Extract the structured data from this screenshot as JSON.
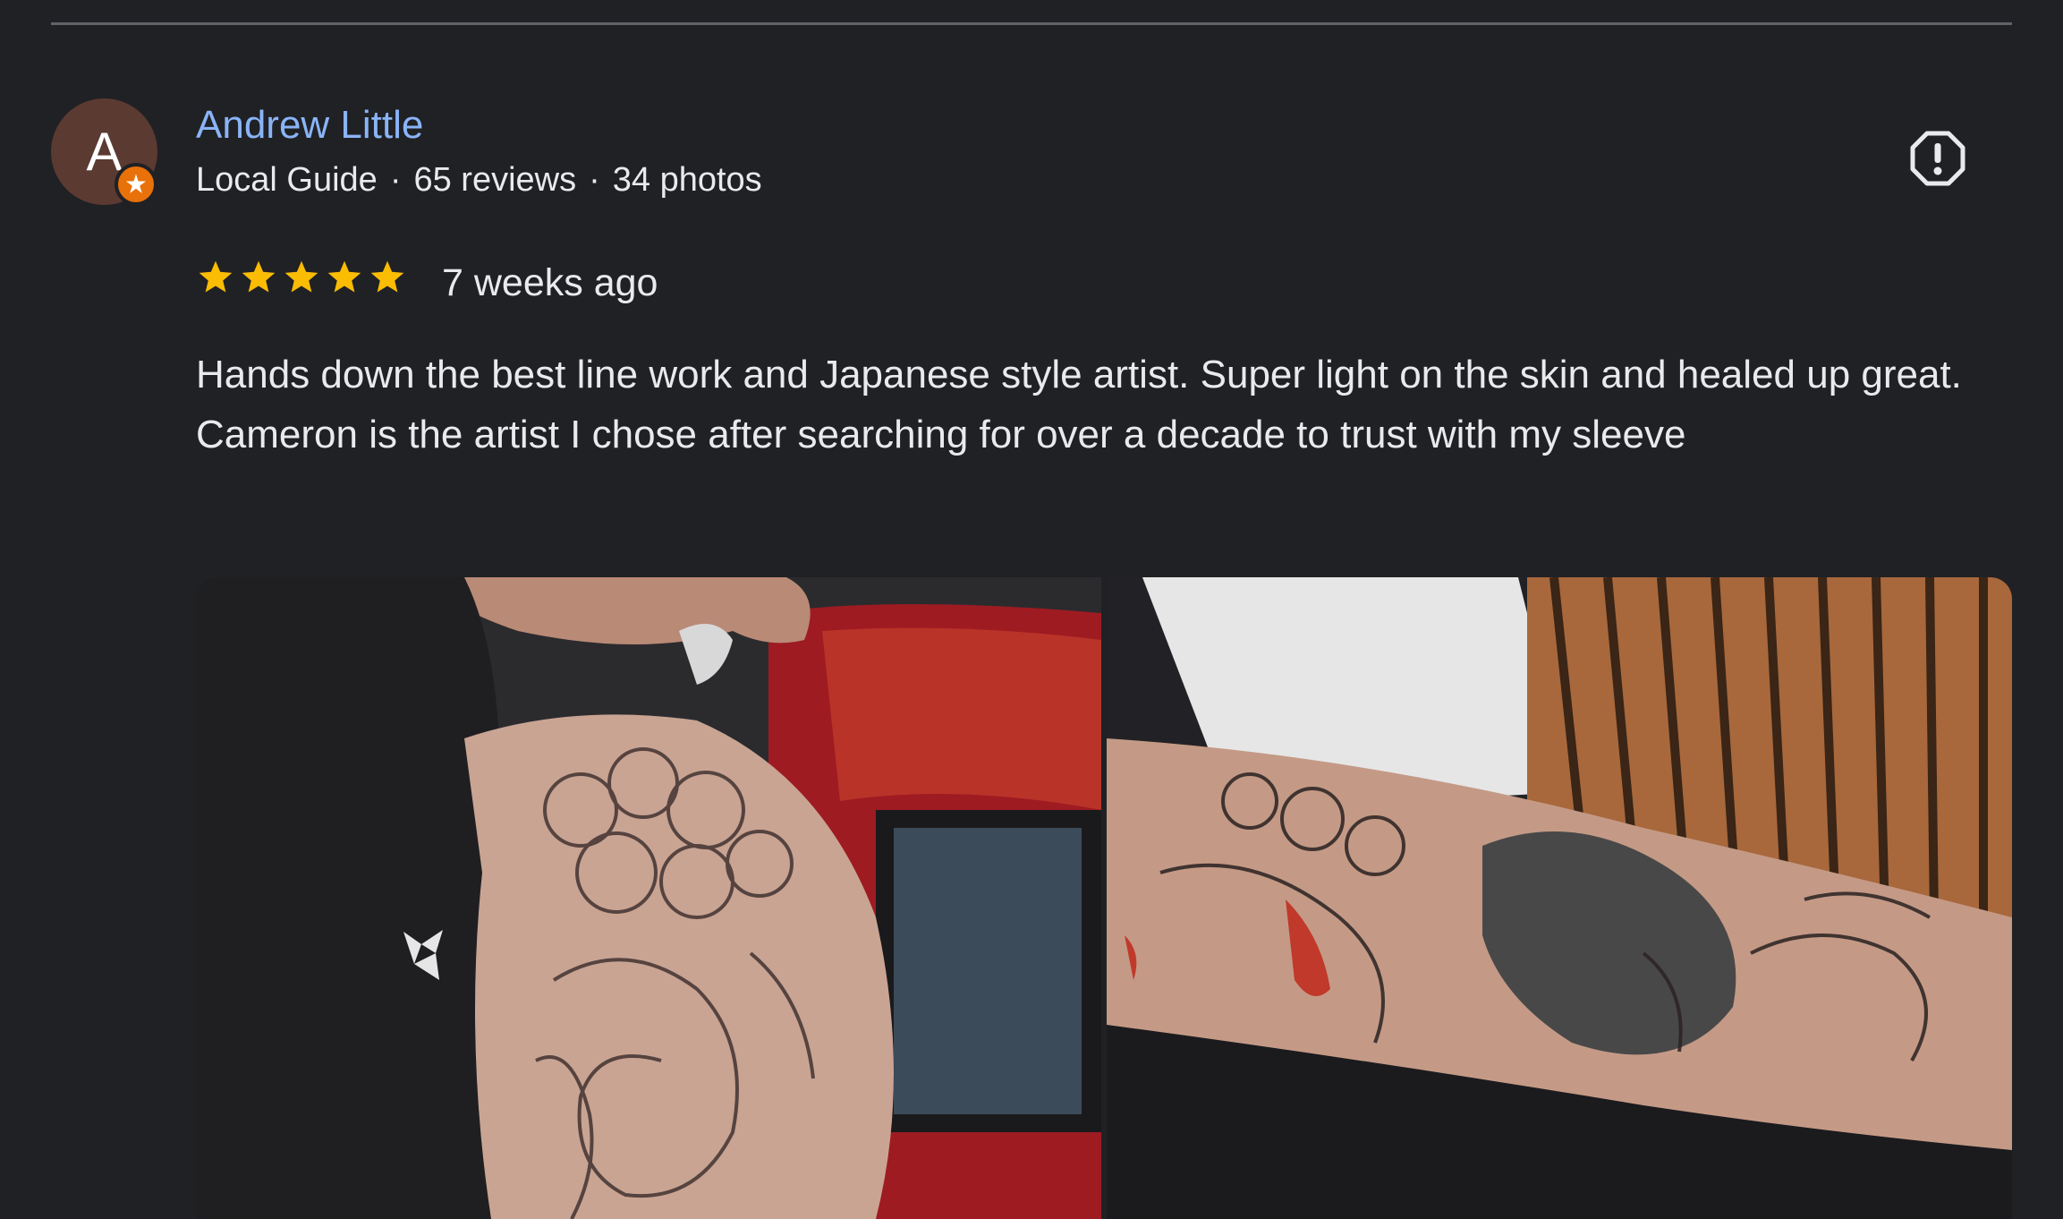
{
  "review": {
    "reviewer": {
      "avatar_initial": "A",
      "avatar_color": "#5b3a32",
      "badge_icon": "local-guide-star-icon",
      "badge_color": "#e8710a",
      "name": "Andrew Little",
      "role": "Local Guide",
      "separator": "·",
      "reviews_count": "65 reviews",
      "photos_count": "34 photos"
    },
    "report_icon": "report-exclamation-icon",
    "rating": 5,
    "rating_max": 5,
    "star_color": "#fbbc04",
    "timestamp": "7 weeks ago",
    "text": "Hands down the best line work and Japanese style artist. Super light on the skin and healed up great. Cameron is the artist I chose after searching for over a decade to trust with my sleeve",
    "photos": [
      {
        "subject": "shoulder-tattoo-photo"
      },
      {
        "subject": "arm-sleeve-tattoo-photo"
      }
    ]
  },
  "colors": {
    "background": "#202124",
    "name_link": "#8ab4f8",
    "text": "#e8eaed",
    "divider": "#5f6368"
  }
}
